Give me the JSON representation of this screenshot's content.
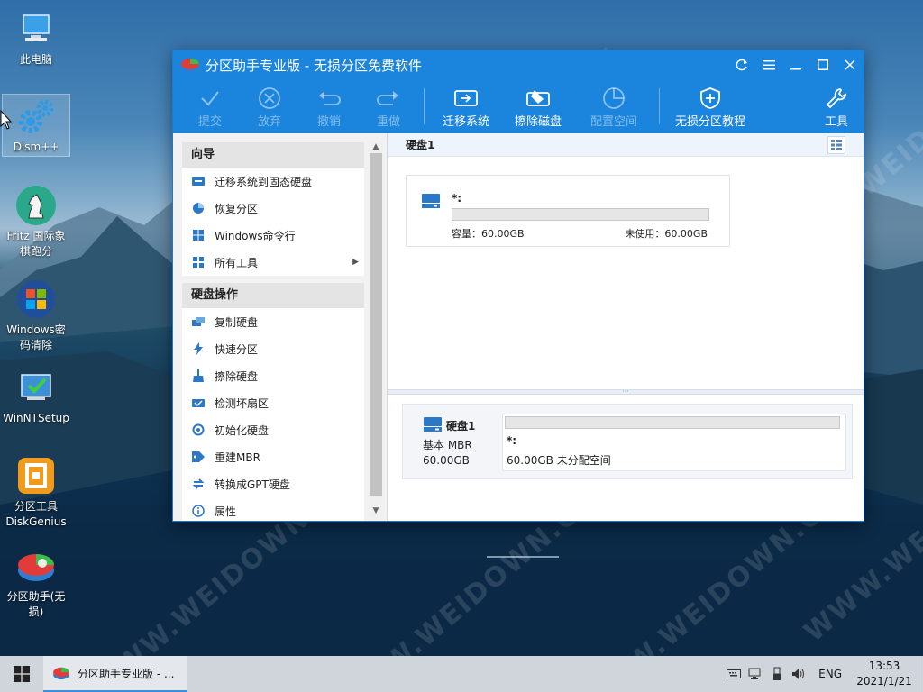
{
  "desktop": {
    "icons": [
      {
        "label": "此电脑",
        "icon": "computer-icon"
      },
      {
        "label": "Dism++",
        "icon": "gear-icon"
      },
      {
        "label": "Fritz 国际象棋跑分",
        "icon": "chess-knight-icon"
      },
      {
        "label": "Windows密码清除",
        "icon": "windows-logo-icon"
      },
      {
        "label": "WinNTSetup",
        "icon": "setup-icon"
      },
      {
        "label": "分区工具DiskGenius",
        "icon": "diskgenius-icon"
      },
      {
        "label": "分区助手(无损)",
        "icon": "partition-assistant-icon"
      }
    ],
    "watermark": "WWW.WEIDOWN.COM"
  },
  "window": {
    "title": "分区助手专业版 - 无损分区免费软件",
    "toolbar": {
      "commit": "提交",
      "discard": "放弃",
      "undo": "撤销",
      "redo": "重做",
      "migrate": "迁移系统",
      "wipe": "擦除磁盘",
      "allocate": "配置空间",
      "tutorial": "无损分区教程",
      "tools": "工具"
    },
    "sidebar": {
      "wizard_title": "向导",
      "wizard_items": [
        {
          "label": "迁移系统到固态硬盘",
          "icon": "migrate-icon"
        },
        {
          "label": "恢复分区",
          "icon": "recover-icon"
        },
        {
          "label": "Windows命令行",
          "icon": "windows-icon"
        },
        {
          "label": "所有工具",
          "icon": "all-tools-icon"
        }
      ],
      "disk_ops_title": "硬盘操作",
      "disk_items": [
        {
          "label": "复制硬盘",
          "icon": "copy-disk-icon"
        },
        {
          "label": "快速分区",
          "icon": "lightning-icon"
        },
        {
          "label": "擦除硬盘",
          "icon": "broom-icon"
        },
        {
          "label": "检测坏扇区",
          "icon": "check-disk-icon"
        },
        {
          "label": "初始化硬盘",
          "icon": "initialize-icon"
        },
        {
          "label": "重建MBR",
          "icon": "tag-icon"
        },
        {
          "label": "转换成GPT硬盘",
          "icon": "convert-icon"
        },
        {
          "label": "属性",
          "icon": "info-icon"
        }
      ]
    },
    "main": {
      "disk_header": "硬盘1",
      "card": {
        "partition_label": "*:",
        "capacity": "容量：60.00GB",
        "unused": "未使用：60.00GB"
      },
      "lower": {
        "disk_name": "硬盘1",
        "disk_type": "基本 MBR",
        "disk_size": "60.00GB",
        "partition_name": "*:",
        "partition_desc": "60.00GB 未分配空间"
      }
    }
  },
  "taskbar": {
    "task_label": "分区助手专业版 - ...",
    "lang": "ENG",
    "time": "13:53",
    "date": "2021/1/21"
  },
  "colors": {
    "titlebar": "#1b84dc",
    "taskbar": "#cfd5db",
    "accent": "#3b8fd8"
  }
}
